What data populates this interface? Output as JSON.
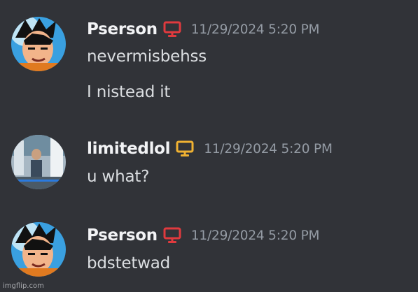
{
  "messages": [
    {
      "username": "Pserson",
      "icon": "monitor-icon",
      "icon_color": "#e03a3e",
      "timestamp": "11/29/2024 5:20 PM",
      "lines": [
        "nevermisbehss",
        "I nistead it"
      ]
    },
    {
      "username": "limitedlol",
      "icon": "monitor-icon",
      "icon_color": "#f0b232",
      "timestamp": "11/29/2024 5:20 PM",
      "lines": [
        "u what?"
      ]
    },
    {
      "username": "Pserson",
      "icon": "monitor-icon",
      "icon_color": "#e03a3e",
      "timestamp": "11/29/2024 5:20 PM",
      "lines": [
        "bdstetwad"
      ]
    }
  ],
  "watermark": "imgflip.com",
  "colors": {
    "background": "#313338",
    "username": "#f2f3f5",
    "timestamp": "#949ba4",
    "message_text": "#dbdee1"
  }
}
